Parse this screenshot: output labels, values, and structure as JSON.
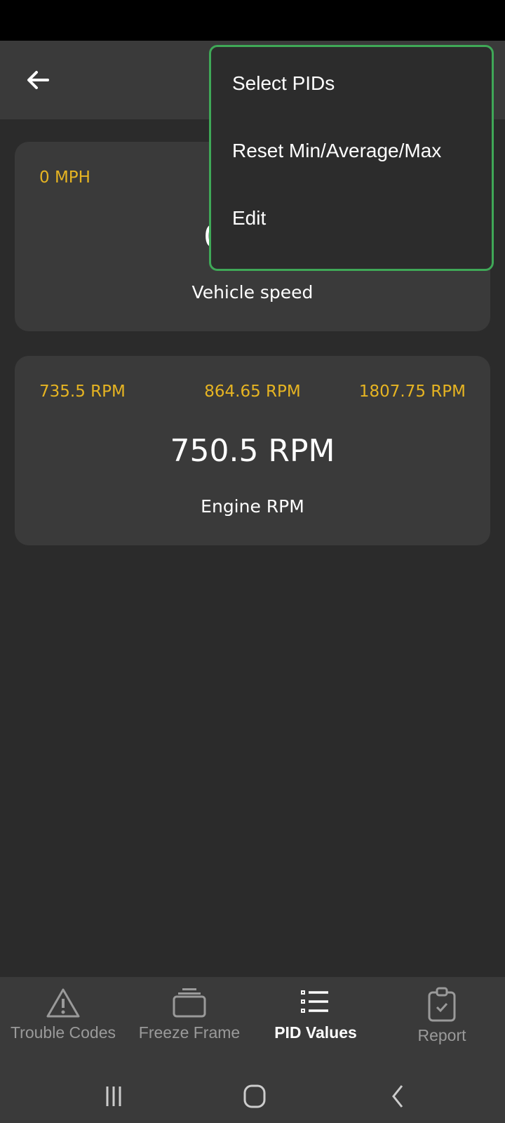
{
  "menu": {
    "items": [
      "Select PIDs",
      "Reset Min/Average/Max",
      "Edit"
    ]
  },
  "cards": [
    {
      "min": "0 MPH",
      "value": "0 MPH",
      "label": "Vehicle speed"
    },
    {
      "min": "735.5 RPM",
      "average": "864.65 RPM",
      "max": "1807.75 RPM",
      "value": "750.5 RPM",
      "label": "Engine RPM"
    }
  ],
  "nav": {
    "tabs": [
      {
        "label": "Trouble Codes"
      },
      {
        "label": "Freeze Frame"
      },
      {
        "label": "PID Values",
        "active": true
      },
      {
        "label": "Report"
      }
    ]
  },
  "colors": {
    "accent": "#e6b422",
    "menu_border": "#3fa857"
  }
}
